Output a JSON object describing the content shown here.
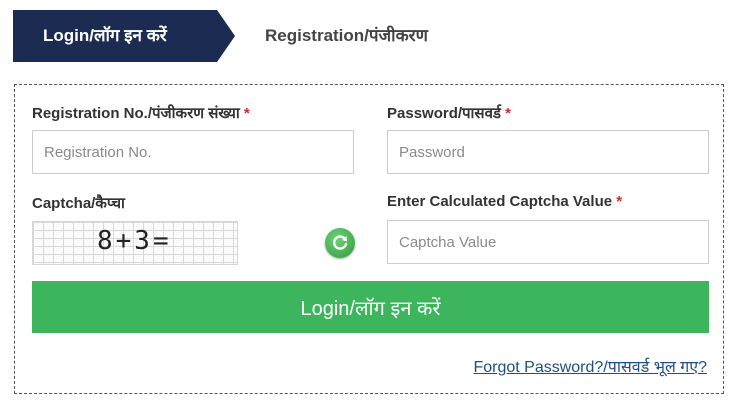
{
  "tabs": {
    "login": "Login/लॉग इन करें",
    "registration": "Registration/पंजीकरण"
  },
  "form": {
    "registration_label": "Registration No./पंजीकरण संख्या",
    "registration_placeholder": "Registration No.",
    "password_label": "Password/पासवर्ड",
    "password_placeholder": "Password",
    "captcha_label": "Captcha/कैप्चा",
    "captcha_text": "8+3=",
    "captcha_value_label": "Enter Calculated Captcha Value",
    "captcha_value_placeholder": "Captcha Value",
    "required_mark": "*",
    "login_button": "Login/लॉग इन करें",
    "forgot_password": "Forgot Password?/पासवर्ड भूल गए?"
  },
  "colors": {
    "tab_active_bg": "#1c2b52",
    "login_button_bg": "#3cb55c",
    "required": "#d9232d",
    "link": "#1f4f82"
  },
  "icons": {
    "refresh": "refresh-icon"
  }
}
